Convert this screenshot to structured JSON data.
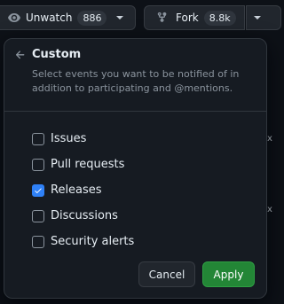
{
  "header": {
    "watch": {
      "label": "Unwatch",
      "count": "886"
    },
    "fork": {
      "label": "Fork",
      "count": "8.8k"
    }
  },
  "dialog": {
    "title": "Custom",
    "description": "Select events you want to be notified of in addition to participating and @mentions.",
    "items": [
      {
        "label": "Issues",
        "checked": false
      },
      {
        "label": "Pull requests",
        "checked": false
      },
      {
        "label": "Releases",
        "checked": true
      },
      {
        "label": "Discussions",
        "checked": false
      },
      {
        "label": "Security alerts",
        "checked": false
      }
    ],
    "cancel_label": "Cancel",
    "apply_label": "Apply"
  },
  "colors": {
    "background": "#0d1117",
    "overlay": "#161b22",
    "accent_checkbox": "#2f81f7",
    "primary_button": "#238636"
  },
  "icons": [
    "eye-icon",
    "chevron-down-icon",
    "repo-forked-icon",
    "arrow-left-icon",
    "check-icon"
  ]
}
